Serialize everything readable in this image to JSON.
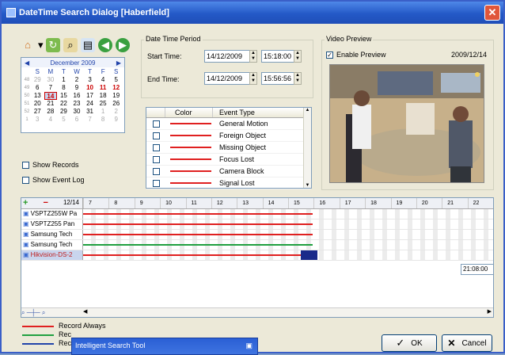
{
  "title": "DateTime Search Dialog  [Haberfield]",
  "calendar": {
    "month_label": "December 2009",
    "day_names": [
      "S",
      "M",
      "T",
      "W",
      "T",
      "F",
      "S"
    ],
    "weeks": [
      {
        "wk": "48",
        "days": [
          "29",
          "30",
          "1",
          "2",
          "3",
          "4",
          "5"
        ]
      },
      {
        "wk": "49",
        "days": [
          "6",
          "7",
          "8",
          "9",
          "10",
          "11",
          "12"
        ]
      },
      {
        "wk": "50",
        "days": [
          "13",
          "14",
          "15",
          "16",
          "17",
          "18",
          "19"
        ]
      },
      {
        "wk": "51",
        "days": [
          "20",
          "21",
          "22",
          "23",
          "24",
          "25",
          "26"
        ]
      },
      {
        "wk": "52",
        "days": [
          "27",
          "28",
          "29",
          "30",
          "31",
          "1",
          "2"
        ]
      },
      {
        "wk": "1",
        "days": [
          "3",
          "4",
          "5",
          "6",
          "7",
          "8",
          "9"
        ]
      }
    ],
    "selected_day": "14"
  },
  "options": {
    "show_records": "Show Records",
    "show_event_log": "Show Event Log"
  },
  "datetime": {
    "group_label": "Date Time Period",
    "start_label": "Start Time:",
    "start_date": "14/12/2009",
    "start_time": "15:18:00",
    "end_label": "End Time:",
    "end_date": "14/12/2009",
    "end_time": "15:56:56"
  },
  "events": {
    "col_color": "Color",
    "col_type": "Event Type",
    "rows": [
      "General Motion",
      "Foreign Object",
      "Missing Object",
      "Focus Lost",
      "Camera Block",
      "Signal Lost"
    ],
    "line_color": "#e02020"
  },
  "preview": {
    "group_label": "Video Preview",
    "enable_label": "Enable Preview",
    "date": "2009/12/14"
  },
  "timeline": {
    "date_label": "12/14",
    "hours": [
      "7",
      "8",
      "9",
      "10",
      "11",
      "12",
      "13",
      "14",
      "15",
      "16",
      "17",
      "18",
      "19",
      "20",
      "21",
      "22"
    ],
    "cameras": [
      {
        "name": "VSPTZ255W Pa",
        "color": "#e02020"
      },
      {
        "name": "VSPTZ255  Pan",
        "color": "#e02020"
      },
      {
        "name": "Samsung Tech",
        "color": "#e02020"
      },
      {
        "name": "Samsung Tech",
        "color": "#20a040"
      },
      {
        "name": "Hikvision-DS-2",
        "color": "#e02020"
      }
    ],
    "time_tooltip": "21:08:00"
  },
  "legend": [
    {
      "label": "Record Always",
      "color": "#e02020"
    },
    {
      "label": "Rec",
      "color": "#20a040"
    },
    {
      "label": "Rec",
      "color": "#2244aa"
    }
  ],
  "popup": {
    "title": "Intelligent Search Tool"
  },
  "buttons": {
    "ok": "OK",
    "cancel": "Cancel"
  }
}
